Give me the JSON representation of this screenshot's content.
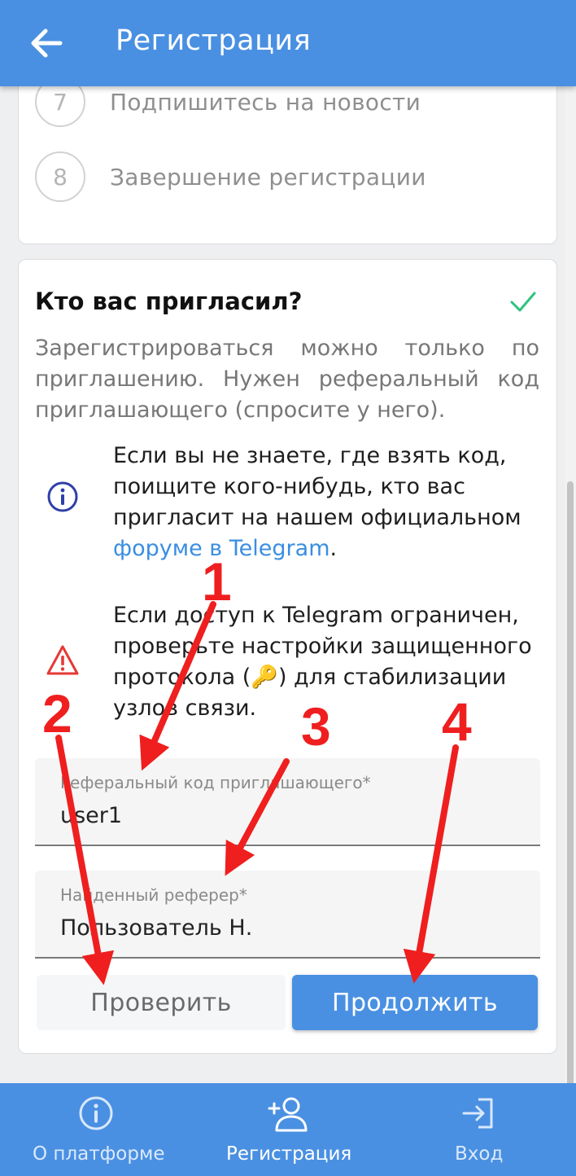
{
  "header": {
    "title": "Регистрация"
  },
  "steps": [
    {
      "number": "7",
      "label": "Подпишитесь на новости"
    },
    {
      "number": "8",
      "label": "Завершение регистрации"
    }
  ],
  "referral": {
    "title": "Кто вас пригласил?",
    "description": "Зарегистрироваться можно только по приглашению. Нужен реферальный код приглашающего (спросите у него).",
    "info": {
      "text": "Если вы не знаете, где взять код, поищите кого-нибудь, кто вас пригласит на нашем официальном",
      "link": "форуме в Telegram",
      "suffix": "."
    },
    "warning": {
      "text_before": "Если доступ к Telegram ограничен, проверьте настройки защищенного протокола (",
      "key_icon": "🔑",
      "text_after": ") для стабилизации узлов связи."
    },
    "code_field": {
      "label": "Реферальный код приглашающего*",
      "value": "user1"
    },
    "referrer_field": {
      "label": "Найденный реферер*",
      "value": "Пользователь Н."
    },
    "check_button": "Проверить",
    "continue_button": "Продолжить"
  },
  "bottom_nav": [
    {
      "label": "О платформе",
      "icon": "info-icon"
    },
    {
      "label": "Регистрация",
      "icon": "add-user-icon"
    },
    {
      "label": "Вход",
      "icon": "login-icon"
    }
  ],
  "annotations": [
    "1",
    "2",
    "3",
    "4"
  ],
  "colors": {
    "primary": "#4a90e2",
    "link": "#3a8ee0",
    "success": "#2ec27e",
    "warning": "#e53935",
    "annotation": "#ef1f1f"
  }
}
